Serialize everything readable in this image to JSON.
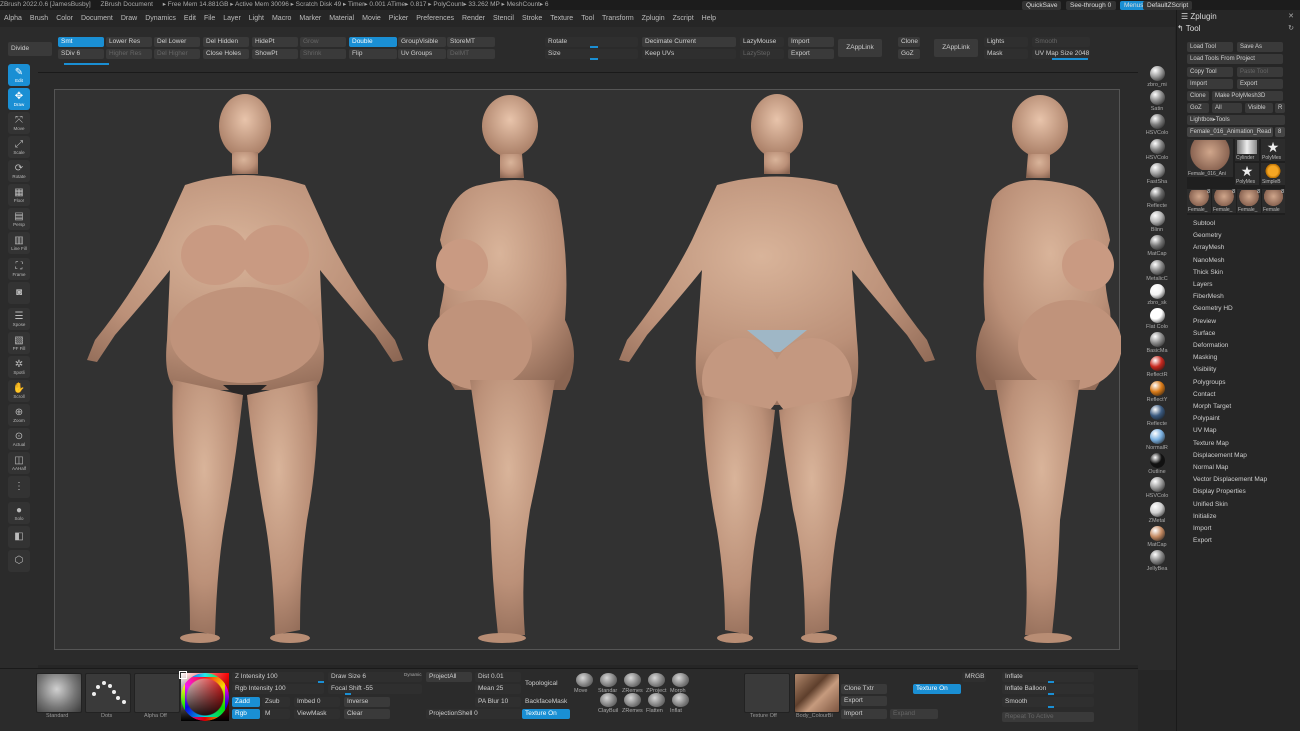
{
  "titlebar": {
    "items": [
      "ZBrush 2022.0.6 [JamesBusby]",
      "ZBrush Document",
      "▸ Free Mem 14.881GB ▸ Active Mem 30096 ▸ Scratch Disk 49 ▸ Timer▸ 0.001 ATime▸ 0.817 ▸ PolyCount▸ 33.262 MP ▸ MeshCount▸ 6"
    ],
    "quicksave": "QuickSave",
    "seethrough": "See-through  0",
    "menus_btn": "Menus",
    "defaultzscript": "DefaultZScript"
  },
  "menubar": [
    "Alpha",
    "Brush",
    "Color",
    "Document",
    "Draw",
    "Dynamics",
    "Edit",
    "File",
    "Layer",
    "Light",
    "Macro",
    "Marker",
    "Material",
    "Movie",
    "Picker",
    "Preferences",
    "Render",
    "Stencil",
    "Stroke",
    "Texture",
    "Tool",
    "Transform",
    "Zplugin",
    "Zscript",
    "Help"
  ],
  "topshelf": {
    "divide": "Divide",
    "smt": "Smt",
    "sdiv": "SDiv 6",
    "lower_res": "Lower Res",
    "higher_res": "Higher Res",
    "del_lower": "Del Lower",
    "del_higher": "Del Higher",
    "del_hidden": "Del Hidden",
    "close_holes": "Close Holes",
    "hidept": "HidePt",
    "showpt": "ShowPt",
    "grow": "Grow",
    "shrink": "Shrink",
    "double": "Double",
    "flip": "Flip",
    "groupvisible": "GroupVisible",
    "uv_groups": "Uv Groups",
    "storemt": "StoreMT",
    "delmt": "DelMT",
    "rotate": "Rotate",
    "size": "Size",
    "decimate_current": "Decimate Current",
    "keep_uvs": "Keep UVs",
    "lazymouse": "LazyMouse",
    "lazystep": "LazyStep",
    "import": "Import",
    "export": "Export",
    "zapplink": "ZAppLink",
    "clone": "Clone",
    "goz": "GoZ",
    "zapplink2": "ZAppLink",
    "lights": "Lights",
    "mask": "Mask",
    "smooth": "Smooth",
    "uv_map_size": "UV Map Size 2048"
  },
  "leftshelf": [
    {
      "label": "Edit",
      "glyph": "✎",
      "on": true
    },
    {
      "label": "Draw",
      "glyph": "✥",
      "on": true
    },
    {
      "label": "Move",
      "glyph": "⤧",
      "on": false
    },
    {
      "label": "Scale",
      "glyph": "⤢",
      "on": false
    },
    {
      "label": "Rotate",
      "glyph": "⟳",
      "on": false
    },
    {
      "label": "Floor",
      "glyph": "▦",
      "on": false
    },
    {
      "label": "Persp",
      "glyph": "▤",
      "on": false
    },
    {
      "label": "Line Fill",
      "glyph": "▥",
      "on": false
    },
    {
      "label": "Frame",
      "glyph": "⛶",
      "on": false
    },
    {
      "label": "",
      "glyph": "◙",
      "on": false
    },
    {
      "label": "Xpose",
      "glyph": "☰",
      "on": false
    },
    {
      "label": "PF Fill",
      "glyph": "▧",
      "on": false
    },
    {
      "label": "Spotli",
      "glyph": "✲",
      "on": false
    },
    {
      "label": "Scroll",
      "glyph": "✋",
      "on": false
    },
    {
      "label": "Zoom",
      "glyph": "⊕",
      "on": false
    },
    {
      "label": "Actual",
      "glyph": "⊙",
      "on": false
    },
    {
      "label": "AAHalf",
      "glyph": "◫",
      "on": false
    },
    {
      "label": "",
      "glyph": "⋮",
      "on": false
    },
    {
      "label": "Solo",
      "glyph": "●",
      "on": false
    },
    {
      "label": "",
      "glyph": "◧",
      "on": false
    },
    {
      "label": "",
      "glyph": "⬡",
      "on": false
    }
  ],
  "materials": [
    {
      "label": "zbro_mi",
      "color": "#9a9a9a"
    },
    {
      "label": "Satin",
      "color": "#8c8c8c"
    },
    {
      "label": "HSVColo",
      "color": "#7a7a7a"
    },
    {
      "label": "HSVColo",
      "color": "#858585"
    },
    {
      "label": "FastSha",
      "color": "#9d9d9d"
    },
    {
      "label": "Reflecte",
      "color": "#6a6a6a"
    },
    {
      "label": "Blinn",
      "color": "#b4b4b4"
    },
    {
      "label": "MatCap",
      "color": "#777777"
    },
    {
      "label": "MetalicC",
      "color": "#8a8a8a"
    },
    {
      "label": "zbro_sk",
      "color": "#f2f2f2"
    },
    {
      "label": "Flat Colo",
      "color": "#ffffff"
    },
    {
      "label": "BasicMa",
      "color": "#8c8c8c"
    },
    {
      "label": "ReflectR",
      "color": "#c8281e"
    },
    {
      "label": "ReflectY",
      "color": "#d97a17"
    },
    {
      "label": "Reflecte",
      "color": "#3a5a80"
    },
    {
      "label": "NormalR",
      "color": "#7ab0e0"
    },
    {
      "label": "Outline",
      "color": "#111111"
    },
    {
      "label": "HSVColo",
      "color": "#9a9a9a"
    },
    {
      "label": "ZMetal",
      "color": "#cfcfcf"
    },
    {
      "label": "MatCap",
      "color": "#c48a62"
    },
    {
      "label": "JellyBea",
      "color": "#8a8a8a"
    }
  ],
  "toolpanel": {
    "zplugin": "Zplugin",
    "tool": "Tool",
    "load_tool": "Load Tool",
    "save_as": "Save As",
    "load_tools_from_project": "Load Tools From Project",
    "copy_tool": "Copy Tool",
    "paste_tool": "Paste Tool",
    "import": "Import",
    "export": "Export",
    "clone": "Clone",
    "make_polymesh3d": "Make PolyMesh3D",
    "goz": "GoZ",
    "all": "All",
    "visible": "Visible",
    "r": "R",
    "lightbox_tools": "Lightbox▸Tools",
    "current_tool": "Female_016_Animation_Read",
    "current_tool_count": "8",
    "thumbs": [
      {
        "label": "Female_016_Ani",
        "kind": "figure",
        "count": ""
      },
      {
        "label": "Cylinder",
        "kind": "cylinder",
        "count": ""
      },
      {
        "label": "PolyMes",
        "kind": "star",
        "count": ""
      },
      {
        "label": "PolyMes",
        "kind": "star",
        "count": ""
      },
      {
        "label": "SimpleB",
        "kind": "simple",
        "count": ""
      },
      {
        "label": "Female_",
        "kind": "small",
        "count": "8"
      },
      {
        "label": "Female_",
        "kind": "small",
        "count": "8"
      },
      {
        "label": "Female_",
        "kind": "small",
        "count": "8"
      },
      {
        "label": "Female",
        "kind": "small",
        "count": "8"
      }
    ],
    "subpalettes": [
      "Subtool",
      "Geometry",
      "ArrayMesh",
      "NanoMesh",
      "Thick Skin",
      "Layers",
      "FiberMesh",
      "Geometry HD",
      "Preview",
      "Surface",
      "Deformation",
      "Masking",
      "Visibility",
      "Polygroups",
      "Contact",
      "Morph Target",
      "Polypaint",
      "UV Map",
      "Texture Map",
      "Displacement Map",
      "Normal Map",
      "Vector Displacement Map",
      "Display Properties",
      "Unified Skin",
      "Initialize",
      "Import",
      "Export"
    ]
  },
  "bottomshelf": {
    "standard": "Standard",
    "dots": "Dots",
    "alpha_off": "Alpha Off",
    "z_intensity": "Z Intensity 100",
    "rgb_intensity": "Rgb Intensity 100",
    "zadd": "Zadd",
    "zsub": "Zsub",
    "rgb": "Rgb",
    "m": "M",
    "draw_size": "Draw Size 6",
    "dynamic": "Dynamic",
    "focal_shift": "Focal Shift -55",
    "imbed": "Imbed 0",
    "viewmask": "ViewMask",
    "inverse": "Inverse",
    "clear": "Clear",
    "projectall": "ProjectAll",
    "dist": "Dist 0.01",
    "mean": "Mean 25",
    "pa_blur": "PA Blur 10",
    "projectionshell": "ProjectionShell 0",
    "topological": "Topological",
    "backfacemask": "BackfaceMask",
    "texture_on": "Texture On",
    "brushes": [
      "Move",
      "Standar",
      "ZRemes",
      "ZProject",
      "Morph",
      "ClayBuil",
      "ZRemes",
      "Flatten",
      "Inflat"
    ],
    "texture_off": "Texture Off",
    "body_texture": "Body_ColourBi",
    "clone_txtr": "Clone Txtr",
    "export": "Export",
    "import": "Import",
    "texture_on2": "Texture On",
    "expand": "Expand",
    "mrgb": "MRGB",
    "inflate": "Inflate",
    "inflate_balloon": "Inflate Balloon",
    "smooth": "Smooth",
    "repeat_to_active": "Repeat To Active"
  },
  "colors": {
    "accent": "#1a8fd4",
    "background": "#262626",
    "canvas": "#323232"
  }
}
